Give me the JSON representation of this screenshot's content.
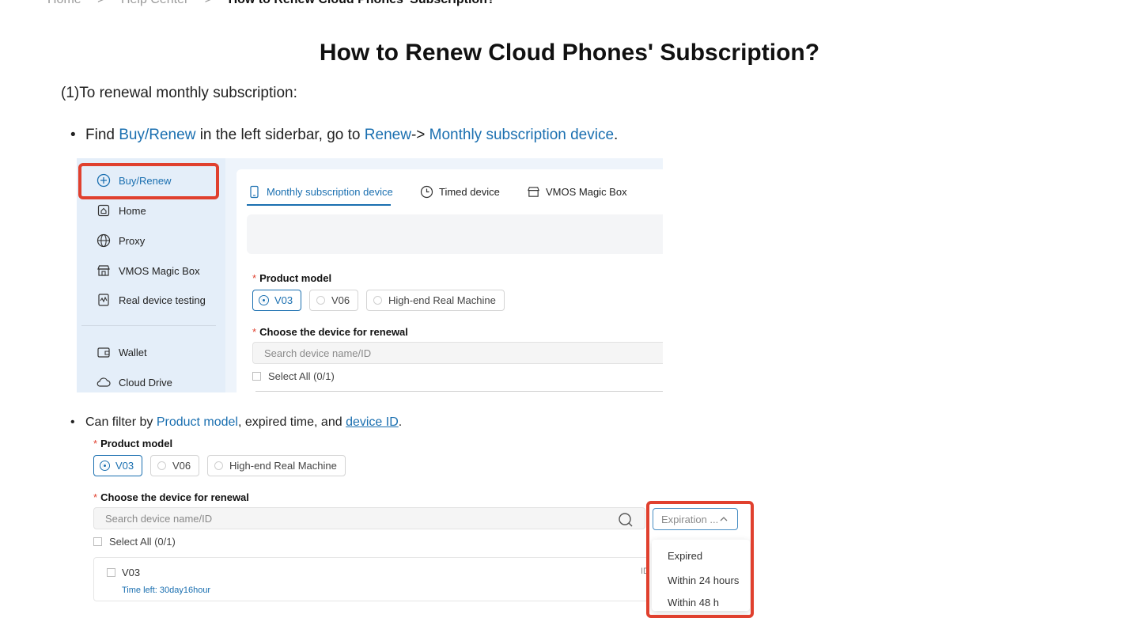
{
  "breadcrumb": {
    "home": "Home",
    "help_center": "Help Center",
    "current": "How to Renew Cloud Phones' Subscription?"
  },
  "title": "How to Renew Cloud Phones' Subscription?",
  "intro": "(1)To renewal monthly subscription:",
  "bullet1": {
    "t1": "Find ",
    "link1": "Buy/Renew",
    "t2": " in the left siderbar, go to ",
    "link2": "Renew",
    "t3": "-> ",
    "link3": "Monthly subscription device",
    "t4": "."
  },
  "bullet2": {
    "t1": "Can filter by ",
    "link1": "Product model",
    "t2": ", expired time, and ",
    "link2": "device ID",
    "t3": "."
  },
  "shot1": {
    "sidebar": [
      "Buy/Renew",
      "Home",
      "Proxy",
      "VMOS Magic Box",
      "Real device testing",
      "Wallet",
      "Cloud Drive"
    ],
    "tabs": [
      "Monthly subscription device",
      "Timed device",
      "VMOS Magic Box"
    ],
    "product_model_label": "Product model",
    "models": [
      "V03",
      "V06",
      "High-end Real Machine"
    ],
    "choose_device_label": "Choose the device for renewal",
    "search_placeholder": "Search device name/ID",
    "select_all": "Select All (0/1)"
  },
  "shot2": {
    "product_model_label": "Product model",
    "models": [
      "V03",
      "V06",
      "High-end Real Machine"
    ],
    "choose_device_label": "Choose the device for renewal",
    "search_placeholder": "Search device name/ID",
    "select_all": "Select All (0/1)",
    "expiration_filter": "Expiration ...",
    "expiration_options": [
      "Expired",
      "Within 24 hours",
      "Within 48 h"
    ],
    "device_name": "V03",
    "time_left": "Time left: 30day16hour",
    "id_label": "ID"
  },
  "colors": {
    "link": "#1a6fb0",
    "highlight": "#e0402e",
    "sidebar_bg": "#e4eef9"
  }
}
